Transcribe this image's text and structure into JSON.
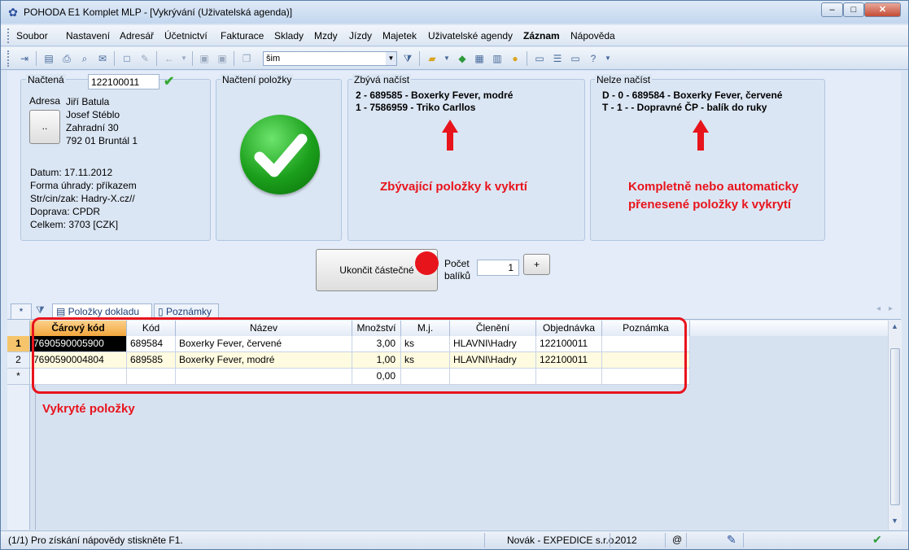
{
  "window": {
    "title": "POHODA E1 Komplet MLP - [Vykrývání (Uživatelská agenda)]",
    "min": "–",
    "max": "□",
    "close": "✕"
  },
  "menu": [
    "Soubor",
    "Nastavení",
    "Adresář",
    "Účetnictví",
    "Fakturace",
    "Sklady",
    "Mzdy",
    "Jízdy",
    "Majetek",
    "Uživatelské agendy",
    "Záznam",
    "Nápověda"
  ],
  "toolbar": {
    "combo_value": "šim"
  },
  "nactena": {
    "label": "Načtená",
    "value": "122100011",
    "address_label": "Adresa",
    "address_button": "..",
    "address_lines": [
      "Jiří Batula",
      "Josef Stéblo",
      "Zahradní 30",
      "792 01 Bruntál 1"
    ],
    "info_lines": [
      "Datum: 17.11.2012",
      "Forma úhrady: příkazem",
      "Str/cin/zak: Hadry-X.cz//",
      "Doprava: CPDR",
      "Celkem: 3703 [CZK]"
    ]
  },
  "nacteni_polozky": {
    "label": "Načtení položky"
  },
  "zbyva": {
    "label": "Zbývá načíst",
    "lines": [
      "2 - 689585 - Boxerky Fever, modré",
      "1 - 7586959 - Triko Carllos"
    ],
    "annotation": "Zbývající položky k vykrtí"
  },
  "nelze": {
    "label": "Nelze načíst",
    "lines": [
      "D - 0 - 689584 - Boxerky Fever, červené",
      "T - 1 -  - Dopravné ČP - balík do ruky"
    ],
    "annotation_1": "Kompletně nebo automaticky",
    "annotation_2": "přenesené položky k vykrytí"
  },
  "actions": {
    "finish_partial": "Ukončit částečné",
    "pocet_label_1": "Počet",
    "pocet_label_2": "balíků",
    "pocet_value": "1",
    "plus": "+"
  },
  "tabs": {
    "asterisk": "*",
    "items_tab": "Položky dokladu",
    "notes_tab": "Poznámky"
  },
  "grid": {
    "columns": [
      "Čárový kód",
      "Kód",
      "Název",
      "Množství",
      "M.j.",
      "Členění",
      "Objednávka",
      "Poznámka"
    ],
    "rows": [
      {
        "num": "1",
        "cells": [
          "7690590005900",
          "689584",
          "Boxerky Fever, červené",
          "3,00",
          "ks",
          "HLAVNI\\Hadry",
          "122100011",
          ""
        ]
      },
      {
        "num": "2",
        "cells": [
          "7690590004804",
          "689585",
          "Boxerky Fever, modré",
          "1,00",
          "ks",
          "HLAVNI\\Hadry",
          "122100011",
          ""
        ]
      },
      {
        "num": "*",
        "cells": [
          "",
          "",
          "",
          "0,00",
          "",
          "",
          "",
          ""
        ]
      }
    ],
    "annotation": "Vykryté položky"
  },
  "status": {
    "help": "(1/1) Pro získání nápovědy stiskněte F1.",
    "user": "Novák - EXPEDICE s.r.o.",
    "year": "2012",
    "at": "@"
  }
}
